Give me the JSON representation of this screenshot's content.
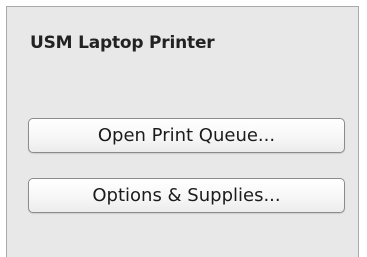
{
  "panel": {
    "title": "USM Laptop Printer",
    "buttons": {
      "open_print_queue": "Open Print Queue...",
      "options_supplies": "Options & Supplies..."
    }
  }
}
